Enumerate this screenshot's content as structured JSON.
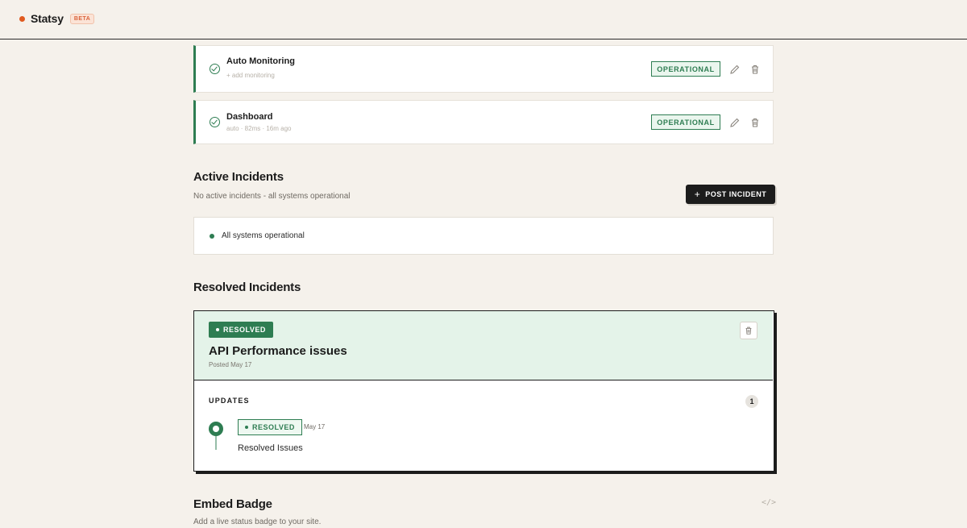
{
  "app": {
    "name": "Statsy",
    "badge": "BETA",
    "accent": "#e05a1f"
  },
  "monitors": [
    {
      "name": "Auto Monitoring",
      "meta": "+ add monitoring",
      "status": "OPERATIONAL"
    },
    {
      "name": "Dashboard",
      "meta": "auto · 82ms · 16m ago",
      "status": "OPERATIONAL"
    }
  ],
  "active": {
    "title": "Active Incidents",
    "subtitle": "No active incidents - all systems operational",
    "post_button": "POST INCIDENT",
    "status_text": "All systems operational"
  },
  "resolved": {
    "title": "Resolved Incidents",
    "incident": {
      "badge": "RESOLVED",
      "title": "API Performance issues",
      "posted": "Posted May 17",
      "updates_label": "UPDATES",
      "updates_count": "1",
      "update": {
        "badge": "RESOLVED",
        "date": "May 17",
        "text": "Resolved Issues"
      }
    }
  },
  "embed": {
    "title": "Embed Badge",
    "subtitle": "Add a live status badge to your site.",
    "icon": "</>"
  },
  "colors": {
    "operational": "#2e7d52",
    "background": "#f5f1eb"
  }
}
